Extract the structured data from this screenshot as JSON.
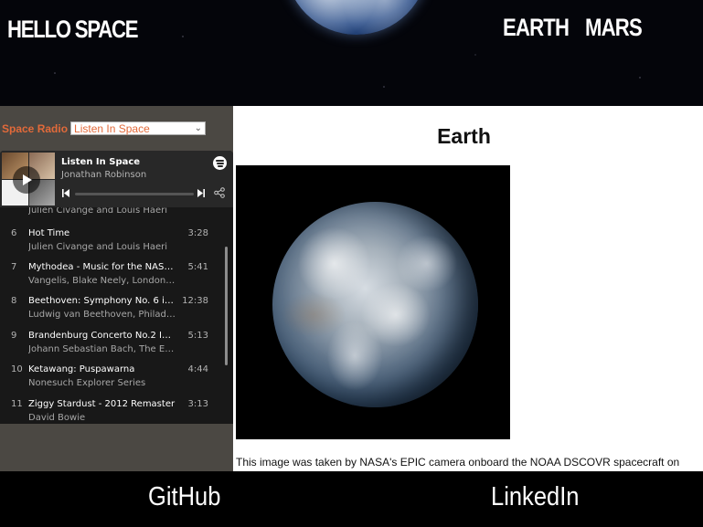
{
  "header": {
    "logo": "HELLO SPACE",
    "nav": [
      "EARTH",
      "MARS"
    ]
  },
  "sidebar": {
    "radio_label": "Space Radio",
    "radio_selected": "Listen In Space"
  },
  "player": {
    "title": "Listen In Space",
    "artist": "Jonathan Robinson",
    "progress": 0.0,
    "tracks": [
      {
        "num": "",
        "name": "",
        "artist": "Julien Civange and Louis Haeri",
        "dur": ""
      },
      {
        "num": "6",
        "name": "Hot Time",
        "artist": "Julien Civange and Louis Haeri",
        "dur": "3:28"
      },
      {
        "num": "7",
        "name": "Mythodea - Music for the NASA ...",
        "artist": "Vangelis, Blake Neely, London M...",
        "dur": "5:41"
      },
      {
        "num": "8",
        "name": "Beethoven: Symphony No. 6 in F ...",
        "artist": "Ludwig van Beethoven, Philadelp...",
        "dur": "12:38"
      },
      {
        "num": "9",
        "name": "Brandenburg Concerto No.2 In F ...",
        "artist": "Johann Sebastian Bach, The Engl...",
        "dur": "5:13"
      },
      {
        "num": "10",
        "name": "Ketawang: Puspawarna",
        "artist": "Nonesuch Explorer Series",
        "dur": "4:44"
      },
      {
        "num": "11",
        "name": "Ziggy Stardust - 2012 Remaster",
        "artist": "David Bowie",
        "dur": "3:13"
      }
    ]
  },
  "main": {
    "title": "Earth",
    "caption": "This image was taken by NASA's EPIC camera onboard the NOAA DSCOVR spacecraft on"
  },
  "footer": {
    "links": [
      "GitHub",
      "LinkedIn"
    ]
  },
  "colors": {
    "accent": "#e26a3a",
    "sidebar_bg": "#4b4843",
    "player_bg": "#181818"
  },
  "icons": [
    "play-icon",
    "spotify-icon",
    "previous-icon",
    "next-icon",
    "share-icon"
  ]
}
